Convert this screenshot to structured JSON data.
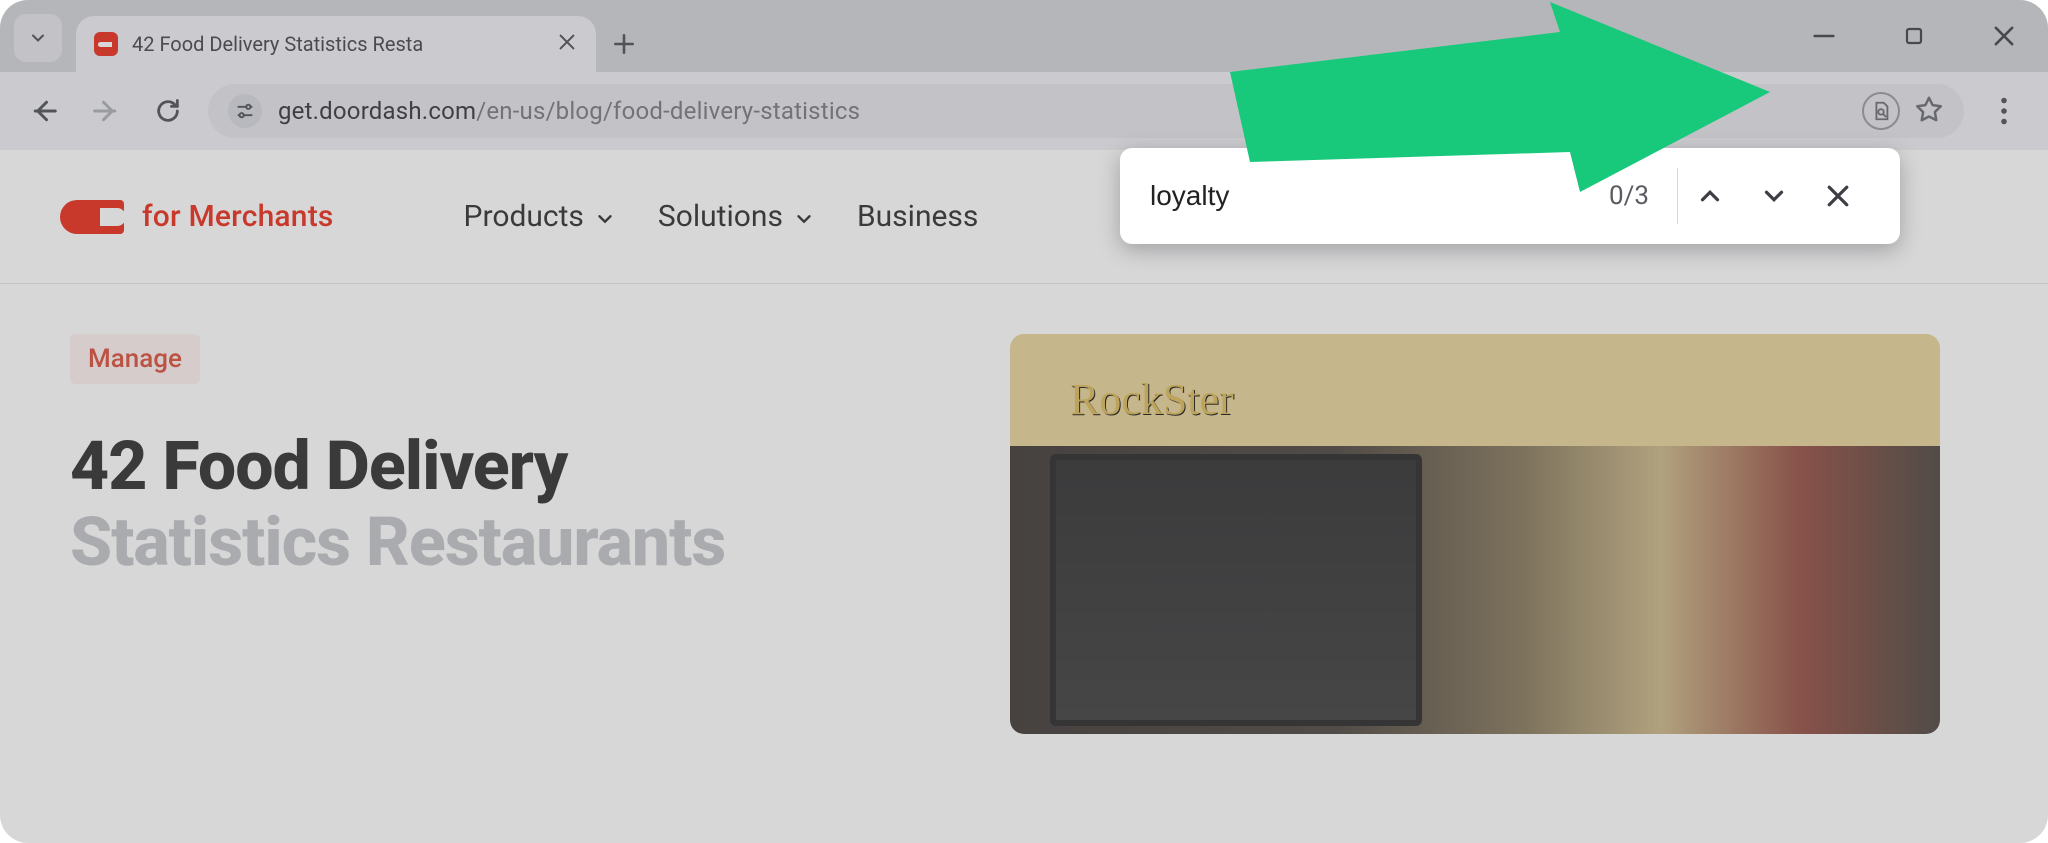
{
  "browser": {
    "tab_title": "42 Food Delivery Statistics Resta",
    "url_host": "get.doordash.com",
    "url_path": "/en-us/blog/food-delivery-statistics"
  },
  "find": {
    "query": "loyalty",
    "count": "0/3"
  },
  "site": {
    "brand": "for Merchants",
    "nav": {
      "products": "Products",
      "solutions": "Solutions",
      "business": "Business"
    },
    "tag": "Manage",
    "headline_line1": "42 Food Delivery",
    "headline_line2": "Statistics Restaurants"
  }
}
